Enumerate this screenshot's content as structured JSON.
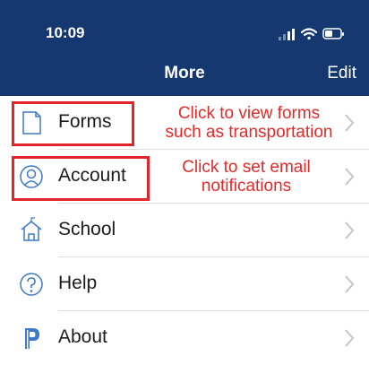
{
  "status_bar": {
    "time": "10:09"
  },
  "nav": {
    "title": "More",
    "edit_label": "Edit"
  },
  "menu": {
    "items": [
      {
        "label": "Forms",
        "icon": "document-icon"
      },
      {
        "label": "Account",
        "icon": "person-icon"
      },
      {
        "label": "School",
        "icon": "school-icon"
      },
      {
        "label": "Help",
        "icon": "help-icon"
      },
      {
        "label": "About",
        "icon": "powerschool-logo-icon"
      }
    ]
  },
  "annotations": {
    "forms_note_line1": "Click to view forms",
    "forms_note_line2": "such as transportation",
    "account_note_line1": "Click to set email",
    "account_note_line2": "notifications"
  },
  "colors": {
    "header_bg": "#14386f",
    "annotation_red": "#e0262a",
    "icon_blue": "#3f78c4"
  }
}
